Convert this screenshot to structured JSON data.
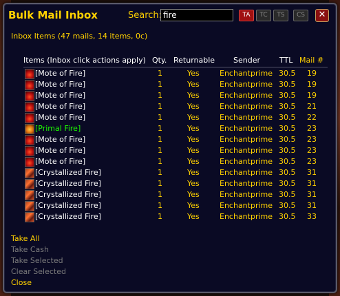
{
  "window": {
    "title": "Bulk Mail Inbox",
    "search_label": "Search:",
    "search_value": "fire",
    "filters": [
      {
        "label": "TA",
        "active": true
      },
      {
        "label": "TC",
        "active": false
      },
      {
        "label": "TS",
        "active": false
      },
      {
        "label": "CS",
        "active": false
      }
    ],
    "close_label": "✕"
  },
  "inbox_info": "Inbox Items (47 mails, 14 items, 0c)",
  "columns": {
    "items": "Items (Inbox click actions apply)",
    "qty": "Qty.",
    "returnable": "Returnable",
    "sender": "Sender",
    "ttl": "TTL",
    "mail": "Mail #"
  },
  "rows": [
    {
      "icon": "mote-of-fire-icon",
      "name": "[Mote of Fire]",
      "quality": "common",
      "qty": "1",
      "returnable": "Yes",
      "sender": "Enchantprime",
      "ttl": "30.5",
      "mail": "19"
    },
    {
      "icon": "mote-of-fire-icon",
      "name": "[Mote of Fire]",
      "quality": "common",
      "qty": "1",
      "returnable": "Yes",
      "sender": "Enchantprime",
      "ttl": "30.5",
      "mail": "19"
    },
    {
      "icon": "mote-of-fire-icon",
      "name": "[Mote of Fire]",
      "quality": "common",
      "qty": "1",
      "returnable": "Yes",
      "sender": "Enchantprime",
      "ttl": "30.5",
      "mail": "19"
    },
    {
      "icon": "mote-of-fire-icon",
      "name": "[Mote of Fire]",
      "quality": "common",
      "qty": "1",
      "returnable": "Yes",
      "sender": "Enchantprime",
      "ttl": "30.5",
      "mail": "21"
    },
    {
      "icon": "mote-of-fire-icon",
      "name": "[Mote of Fire]",
      "quality": "common",
      "qty": "1",
      "returnable": "Yes",
      "sender": "Enchantprime",
      "ttl": "30.5",
      "mail": "22"
    },
    {
      "icon": "primal-fire-icon",
      "name": "[Primal Fire]",
      "quality": "uncommon",
      "qty": "1",
      "returnable": "Yes",
      "sender": "Enchantprime",
      "ttl": "30.5",
      "mail": "23"
    },
    {
      "icon": "mote-of-fire-icon",
      "name": "[Mote of Fire]",
      "quality": "common",
      "qty": "1",
      "returnable": "Yes",
      "sender": "Enchantprime",
      "ttl": "30.5",
      "mail": "23"
    },
    {
      "icon": "mote-of-fire-icon",
      "name": "[Mote of Fire]",
      "quality": "common",
      "qty": "1",
      "returnable": "Yes",
      "sender": "Enchantprime",
      "ttl": "30.5",
      "mail": "23"
    },
    {
      "icon": "mote-of-fire-icon",
      "name": "[Mote of Fire]",
      "quality": "common",
      "qty": "1",
      "returnable": "Yes",
      "sender": "Enchantprime",
      "ttl": "30.5",
      "mail": "23"
    },
    {
      "icon": "crystallized-fire-icon",
      "name": "[Crystallized Fire]",
      "quality": "common",
      "qty": "1",
      "returnable": "Yes",
      "sender": "Enchantprime",
      "ttl": "30.5",
      "mail": "31"
    },
    {
      "icon": "crystallized-fire-icon",
      "name": "[Crystallized Fire]",
      "quality": "common",
      "qty": "1",
      "returnable": "Yes",
      "sender": "Enchantprime",
      "ttl": "30.5",
      "mail": "31"
    },
    {
      "icon": "crystallized-fire-icon",
      "name": "[Crystallized Fire]",
      "quality": "common",
      "qty": "1",
      "returnable": "Yes",
      "sender": "Enchantprime",
      "ttl": "30.5",
      "mail": "31"
    },
    {
      "icon": "crystallized-fire-icon",
      "name": "[Crystallized Fire]",
      "quality": "common",
      "qty": "1",
      "returnable": "Yes",
      "sender": "Enchantprime",
      "ttl": "30.5",
      "mail": "31"
    },
    {
      "icon": "crystallized-fire-icon",
      "name": "[Crystallized Fire]",
      "quality": "common",
      "qty": "1",
      "returnable": "Yes",
      "sender": "Enchantprime",
      "ttl": "30.5",
      "mail": "33"
    }
  ],
  "actions": [
    {
      "label": "Take All",
      "enabled": true
    },
    {
      "label": "Take Cash",
      "enabled": false
    },
    {
      "label": "Take Selected",
      "enabled": false
    },
    {
      "label": "Clear Selected",
      "enabled": false
    },
    {
      "label": "Close",
      "enabled": true
    }
  ],
  "colors": {
    "gold": "#ffd100",
    "uncommon": "#1eff00",
    "disabled": "#7a7a7a",
    "background": "#0a0a24"
  }
}
